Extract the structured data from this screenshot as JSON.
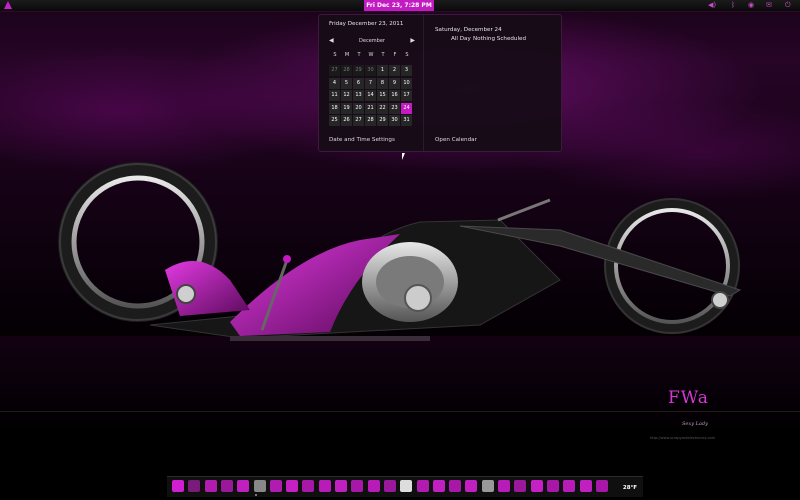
{
  "top_panel": {
    "clock": "Fri Dec 23,  7:28 PM",
    "tray_icons": [
      "volume-icon",
      "bluetooth-icon",
      "network-icon",
      "mail-icon",
      "power-icon"
    ]
  },
  "calendar": {
    "date_heading": "Friday December 23, 2011",
    "month": "December",
    "prev_symbol": "◀",
    "next_symbol": "▶",
    "weekdays": [
      "S",
      "M",
      "T",
      "W",
      "T",
      "F",
      "S"
    ],
    "weeks": [
      [
        "27",
        "28",
        "29",
        "30",
        "1",
        "2",
        "3"
      ],
      [
        "4",
        "5",
        "6",
        "7",
        "8",
        "9",
        "10"
      ],
      [
        "11",
        "12",
        "13",
        "14",
        "15",
        "16",
        "17"
      ],
      [
        "18",
        "19",
        "20",
        "21",
        "22",
        "23",
        "24"
      ],
      [
        "25",
        "26",
        "27",
        "28",
        "29",
        "30",
        "31"
      ]
    ],
    "today_day": "24",
    "date_time_settings": "Date and Time Settings",
    "event_date": "Saturday, December 24",
    "event_allday": "All Day",
    "event_text": "Nothing Scheduled",
    "open_calendar": "Open Calendar"
  },
  "wallpaper": {
    "brand_logo": "FWa",
    "tagline": "Sexy Lady",
    "url": "http://www.scrapyardelectronics.com"
  },
  "dock": {
    "items": [
      {
        "icon": "power-icon",
        "color": "#d01fd0"
      },
      {
        "icon": "terminal-icon",
        "color": "#7a1a7a"
      },
      {
        "icon": "photo-viewer-icon",
        "color": "#b01cb0"
      },
      {
        "icon": "calendar-icon",
        "color": "#9a189a"
      },
      {
        "icon": "chromium-icon",
        "color": "#c020c0"
      },
      {
        "icon": "globe-icon",
        "color": "#888888"
      },
      {
        "icon": "stop-icon",
        "color": "#b01cb0"
      },
      {
        "icon": "feather-icon",
        "color": "#c420c4"
      },
      {
        "icon": "mail-icon",
        "color": "#a818a8"
      },
      {
        "icon": "notes-icon",
        "color": "#b81cb8"
      },
      {
        "icon": "chat-icon",
        "color": "#c020c0"
      },
      {
        "icon": "hearts-icon",
        "color": "#a818a8"
      },
      {
        "icon": "speech-bubble-icon",
        "color": "#b81cb8"
      },
      {
        "icon": "shield-icon",
        "color": "#9a189a"
      },
      {
        "icon": "document-icon",
        "color": "#dddddd"
      },
      {
        "icon": "pdf-icon",
        "color": "#b01cb0"
      },
      {
        "icon": "music-icon",
        "color": "#c020c0"
      },
      {
        "icon": "settings-icon",
        "color": "#a818a8"
      },
      {
        "icon": "cd-icon",
        "color": "#c020c0"
      },
      {
        "icon": "cone-icon",
        "color": "#999999"
      },
      {
        "icon": "folder-icon",
        "color": "#b81cb8"
      },
      {
        "icon": "file-manager-icon",
        "color": "#9a189a"
      },
      {
        "icon": "tablet-icon",
        "color": "#c420c4"
      },
      {
        "icon": "grid-icon",
        "color": "#a818a8"
      },
      {
        "icon": "box-icon",
        "color": "#b81cb8"
      },
      {
        "icon": "monitor-icon",
        "color": "#c020c0"
      },
      {
        "icon": "camera-icon",
        "color": "#a818a8"
      }
    ],
    "weather": "28°F"
  },
  "colors": {
    "accent": "#c21bc2",
    "panel": "#141414",
    "popup": "#160c16"
  }
}
